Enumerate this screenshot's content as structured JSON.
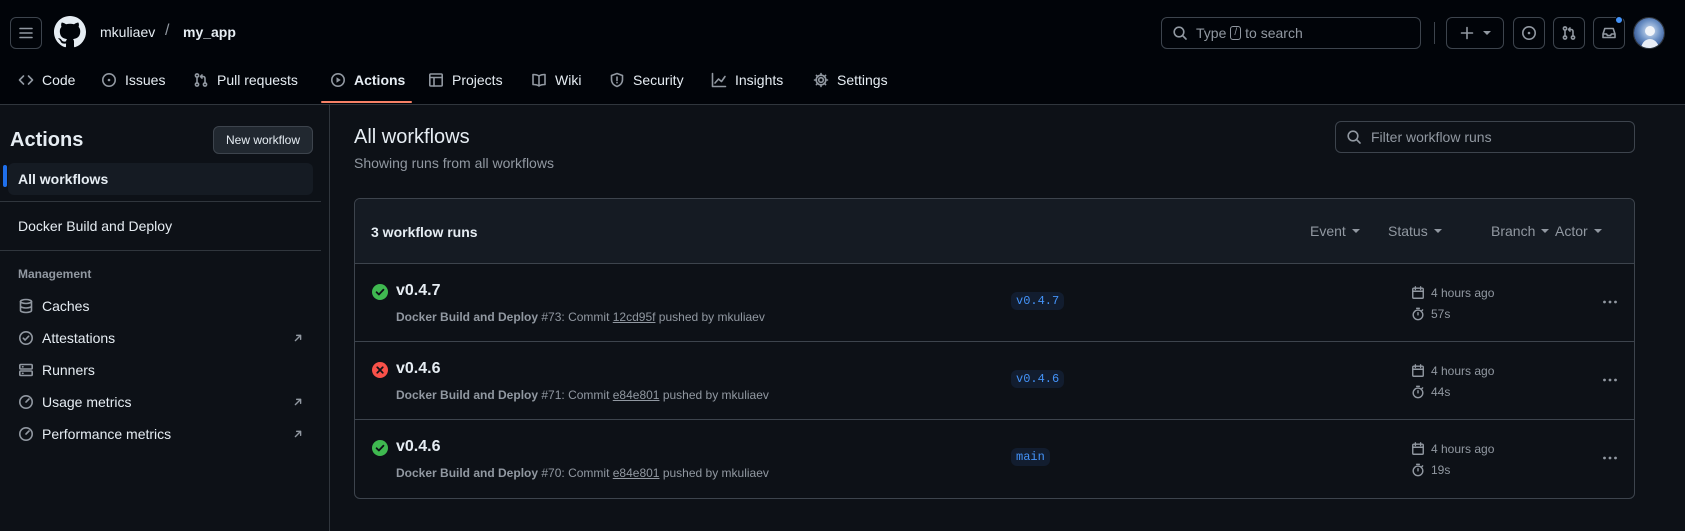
{
  "header": {
    "owner": "mkuliaev",
    "separator": "/",
    "repo": "my_app",
    "search_prefix": "Type",
    "search_key": "/",
    "search_suffix": "to search"
  },
  "repo_nav": [
    {
      "label": "Code",
      "icon": "code-icon"
    },
    {
      "label": "Issues",
      "icon": "issue-opened-icon"
    },
    {
      "label": "Pull requests",
      "icon": "git-pull-request-icon"
    },
    {
      "label": "Actions",
      "icon": "play-icon",
      "active": true
    },
    {
      "label": "Projects",
      "icon": "table-icon"
    },
    {
      "label": "Wiki",
      "icon": "book-icon"
    },
    {
      "label": "Security",
      "icon": "shield-icon"
    },
    {
      "label": "Insights",
      "icon": "graph-icon"
    },
    {
      "label": "Settings",
      "icon": "gear-icon"
    }
  ],
  "sidebar": {
    "title": "Actions",
    "new_workflow": "New workflow",
    "all_workflows": "All workflows",
    "workflow": "Docker Build and Deploy",
    "management_heading": "Management",
    "tools": [
      {
        "label": "Caches",
        "icon": "database-icon"
      },
      {
        "label": "Attestations",
        "icon": "verified-icon",
        "external": true
      },
      {
        "label": "Runners",
        "icon": "server-icon"
      },
      {
        "label": "Usage metrics",
        "icon": "meter-icon",
        "external": true
      },
      {
        "label": "Performance metrics",
        "icon": "meter-icon",
        "external": true
      }
    ]
  },
  "main": {
    "title": "All workflows",
    "subtitle": "Showing runs from all workflows",
    "filter_placeholder": "Filter workflow runs",
    "runs_count": "3 workflow runs",
    "filters": [
      "Event",
      "Status",
      "Branch",
      "Actor"
    ],
    "runs": [
      {
        "status": "success",
        "title": "v0.4.7",
        "workflow": "Docker Build and Deploy",
        "number": "#73: Commit",
        "commit": "12cd95f",
        "pushed_by": "pushed by mkuliaev",
        "branch": "v0.4.7",
        "time": "4 hours ago",
        "duration": "57s"
      },
      {
        "status": "failure",
        "title": "v0.4.6",
        "workflow": "Docker Build and Deploy",
        "number": "#71: Commit",
        "commit": "e84e801",
        "pushed_by": "pushed by mkuliaev",
        "branch": "v0.4.6",
        "time": "4 hours ago",
        "duration": "44s"
      },
      {
        "status": "success",
        "title": "v0.4.6",
        "workflow": "Docker Build and Deploy",
        "number": "#70: Commit",
        "commit": "e84e801",
        "pushed_by": "pushed by mkuliaev",
        "branch": "main",
        "time": "4 hours ago",
        "duration": "19s"
      }
    ]
  },
  "colors": {
    "success": "#3fb950",
    "failure": "#f85149",
    "accent": "#4493f8",
    "active_tab": "#f78166"
  }
}
